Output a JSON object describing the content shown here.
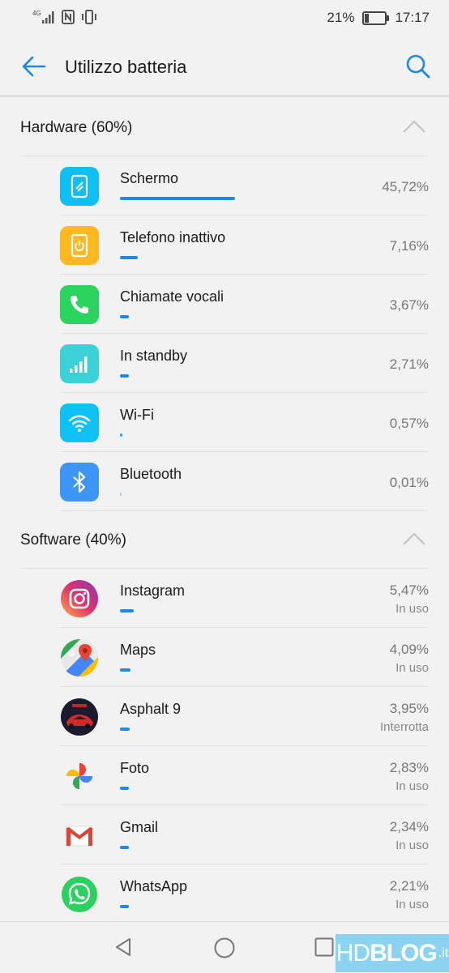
{
  "status": {
    "net": "4G",
    "battery_pct": "21%",
    "battery_level": 0.21,
    "time": "17:17"
  },
  "appbar": {
    "title": "Utilizzo batteria"
  },
  "hardware": {
    "title": "Hardware (60%)",
    "items": [
      {
        "name": "Schermo",
        "pct": "45,72%",
        "value": 45.72,
        "icon": "screen-icon",
        "color": "#0fbff2"
      },
      {
        "name": "Telefono inattivo",
        "pct": "7,16%",
        "value": 7.16,
        "icon": "phone-idle-icon",
        "color": "#ffb820"
      },
      {
        "name": "Chiamate vocali",
        "pct": "3,67%",
        "value": 3.67,
        "icon": "call-icon",
        "color": "#2ad45e"
      },
      {
        "name": "In standby",
        "pct": "2,71%",
        "value": 2.71,
        "icon": "signal-icon",
        "color": "#3ad1d9"
      },
      {
        "name": "Wi-Fi",
        "pct": "0,57%",
        "value": 0.57,
        "icon": "wifi-icon",
        "color": "#10c1f5"
      },
      {
        "name": "Bluetooth",
        "pct": "0,01%",
        "value": 0.01,
        "icon": "bluetooth-icon",
        "color": "#3d95f5"
      }
    ]
  },
  "software": {
    "title": "Software (40%)",
    "items": [
      {
        "name": "Instagram",
        "pct": "5,47%",
        "value": 5.47,
        "sub": "In uso",
        "icon": "instagram-icon"
      },
      {
        "name": "Maps",
        "pct": "4,09%",
        "value": 4.09,
        "sub": "In uso",
        "icon": "maps-icon"
      },
      {
        "name": "Asphalt 9",
        "pct": "3,95%",
        "value": 3.95,
        "sub": "Interrotta",
        "icon": "asphalt-icon"
      },
      {
        "name": "Foto",
        "pct": "2,83%",
        "value": 2.83,
        "sub": "In uso",
        "icon": "photos-icon"
      },
      {
        "name": "Gmail",
        "pct": "2,34%",
        "value": 2.34,
        "sub": "In uso",
        "icon": "gmail-icon"
      },
      {
        "name": "WhatsApp",
        "pct": "2,21%",
        "value": 2.21,
        "sub": "In uso",
        "icon": "whatsapp-icon"
      }
    ]
  },
  "watermark": {
    "a": "HD",
    "b": "BLOG",
    "c": ".it"
  },
  "colors": {
    "accent": "#1e88e5"
  }
}
